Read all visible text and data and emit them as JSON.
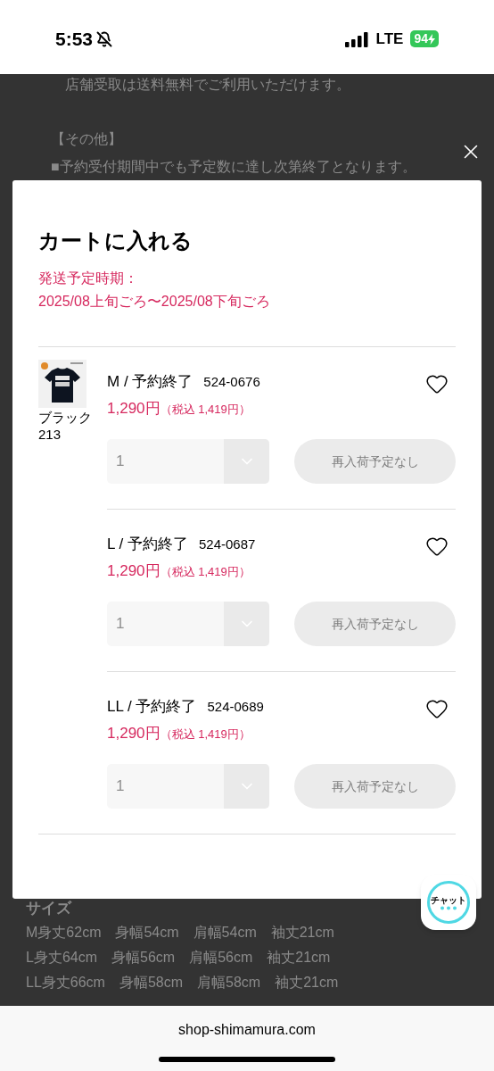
{
  "status_bar": {
    "time": "5:53",
    "network": "LTE",
    "battery": "94"
  },
  "background": {
    "top_lines": [
      {
        "text": "店舗受取は送料無料でご利用いただけます。",
        "indent": true
      },
      {
        "text": "【その他】",
        "indent": false
      },
      {
        "text": "■予約受付期間中でも予定数に達し次第終了となります。",
        "indent": false
      }
    ],
    "size_heading": "サイズ",
    "size_rows": [
      [
        "M身丈62cm",
        "身幅54cm",
        "肩幅54cm",
        "袖丈21cm"
      ],
      [
        "L身丈64cm",
        "身幅56cm",
        "肩幅56cm",
        "袖丈21cm"
      ],
      [
        "LL身丈66cm",
        "身幅58cm",
        "肩幅58cm",
        "袖丈21cm"
      ]
    ]
  },
  "modal": {
    "title": "カートに入れる",
    "shipping_label": "発送予定時期：",
    "shipping_period": "2025/08上旬ごろ〜2025/08下旬ごろ",
    "product": {
      "color_name": "ブラック",
      "color_code": "213"
    },
    "variants": [
      {
        "name": "M / 予約終了",
        "code": "524-0676",
        "price": "1,290円",
        "tax_price": "（税込 1,419円）",
        "quantity": "1",
        "button": "再入荷予定なし",
        "disabled": true,
        "favorite": false
      },
      {
        "name": "L / 予約終了",
        "code": "524-0687",
        "price": "1,290円",
        "tax_price": "（税込 1,419円）",
        "quantity": "1",
        "button": "再入荷予定なし",
        "disabled": true,
        "favorite": false
      },
      {
        "name": "LL / 予約終了",
        "code": "524-0689",
        "price": "1,290円",
        "tax_price": "（税込 1,419円）",
        "quantity": "1",
        "button": "再入荷予定なし",
        "disabled": true,
        "favorite": false
      }
    ]
  },
  "chat": {
    "label": "チャット"
  },
  "address_bar": {
    "url": "shop-shimamura.com"
  }
}
